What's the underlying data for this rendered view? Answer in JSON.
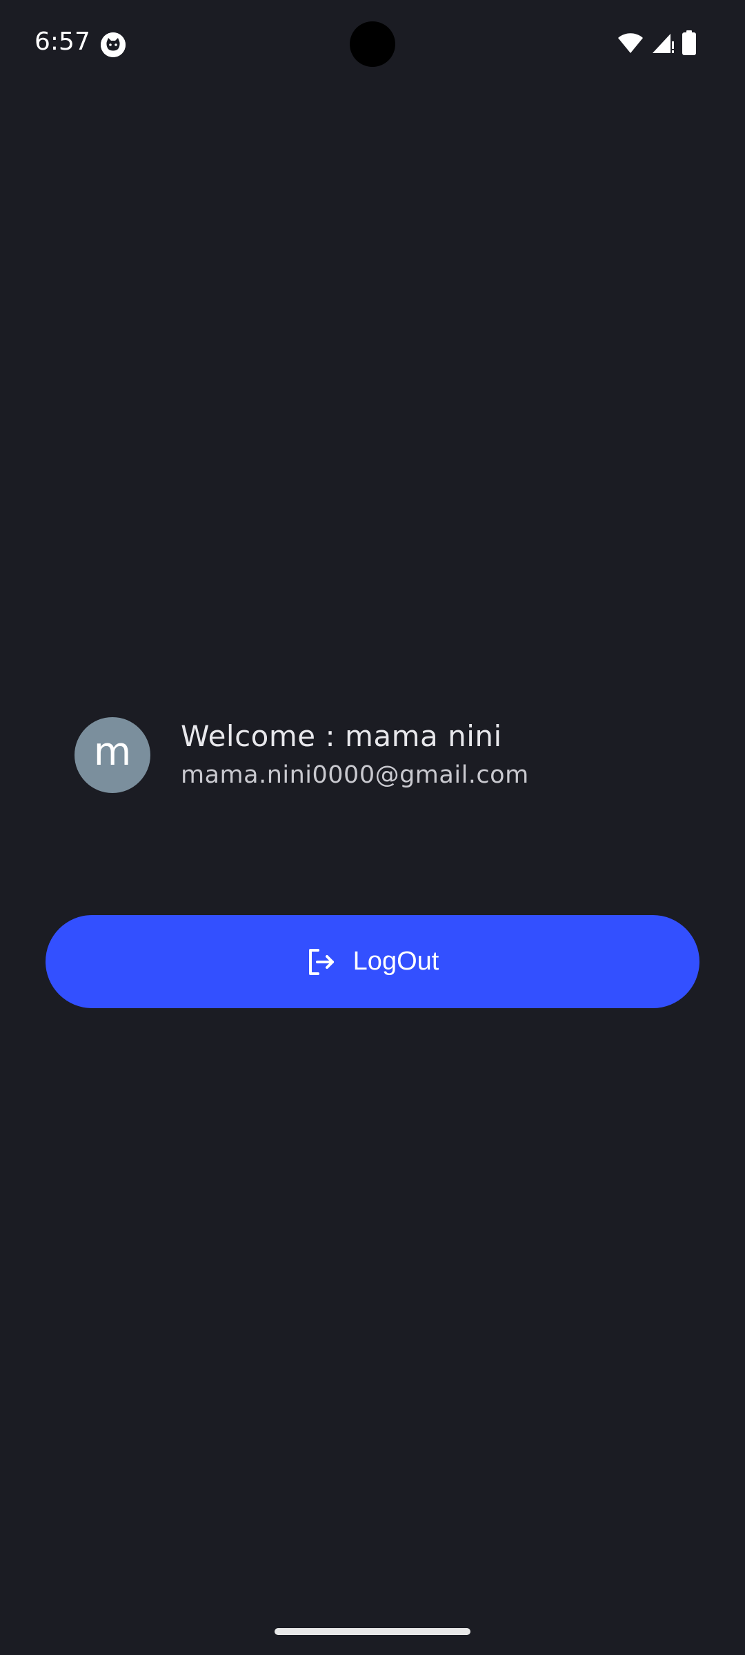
{
  "status_bar": {
    "time": "6:57",
    "app_icon": "cat-face-icon",
    "icons": [
      "wifi-icon",
      "cell-signal-icon",
      "battery-icon"
    ]
  },
  "profile": {
    "avatar_letter": "m",
    "welcome": "Welcome : mama nini",
    "email": "mama.nini0000@gmail.com"
  },
  "logout": {
    "label": "LogOut",
    "icon": "logout-icon"
  },
  "colors": {
    "background": "#1b1c23",
    "accent": "#3350ff",
    "avatar": "#7b8f9d"
  }
}
